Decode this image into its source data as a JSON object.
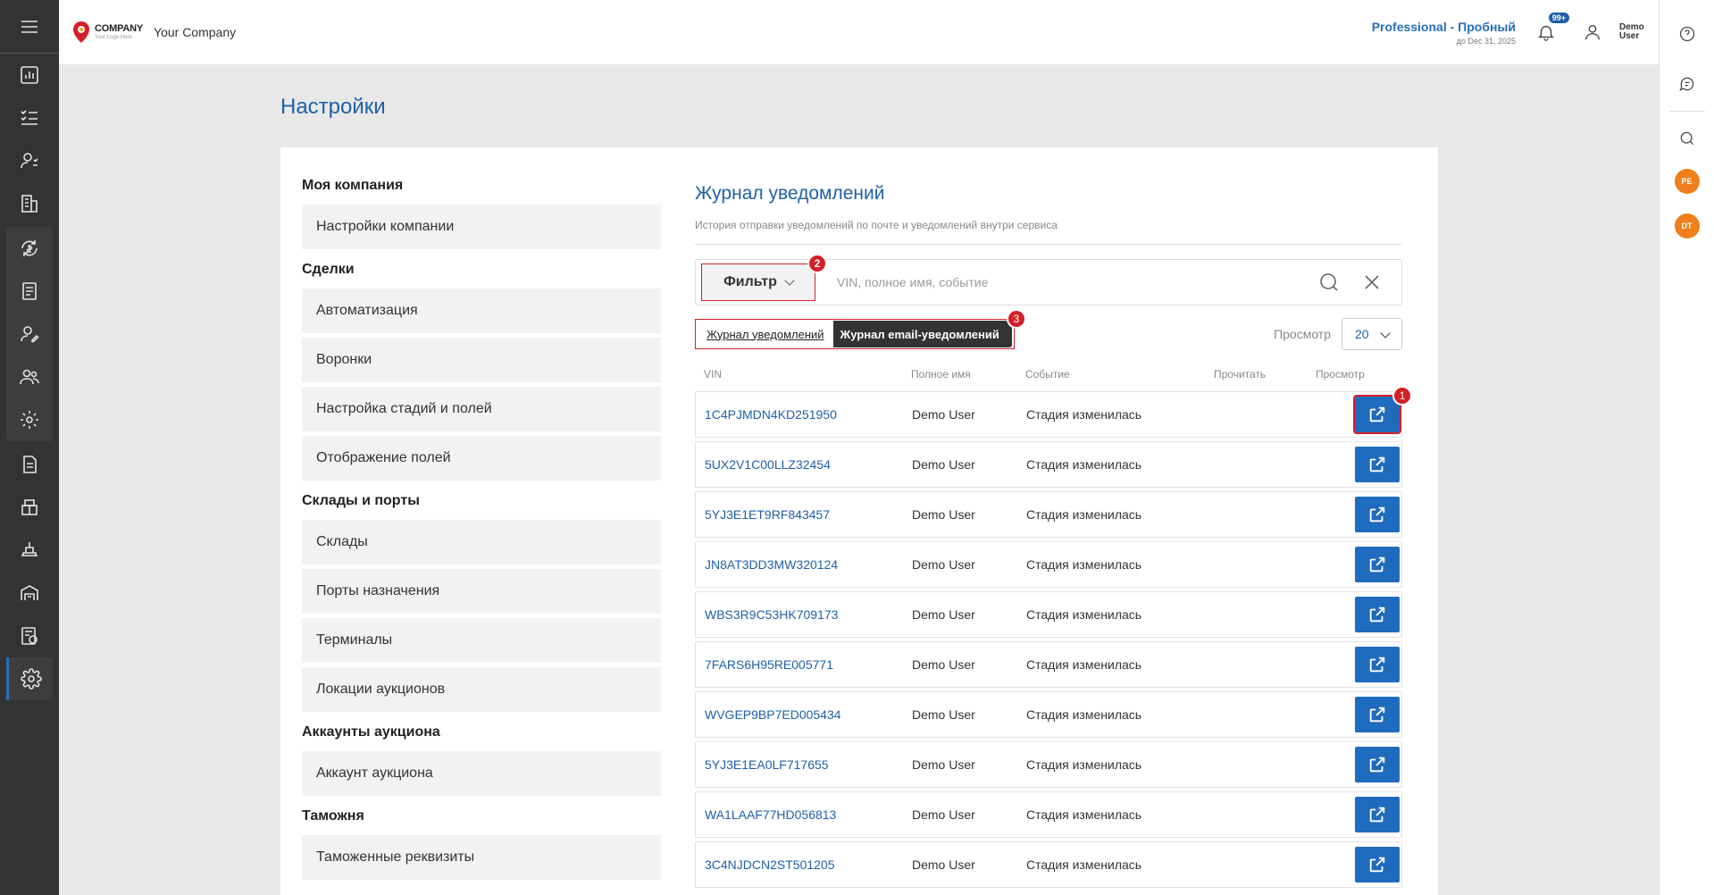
{
  "header": {
    "logo_line1": "COMPANY",
    "logo_line2": "Your Logo Here",
    "company_name": "Your Company",
    "plan_name": "Professional - Пробный",
    "plan_expiry": "до Dec 31, 2025",
    "notifications_badge": "99+",
    "user_name": "Demo User"
  },
  "leftbar": {
    "icons": [
      "menu-icon",
      "dashboard-icon",
      "tasks-icon",
      "clients-icon",
      "buildings-icon",
      "sync-icon",
      "documents-icon",
      "user-edit-icon",
      "users-icon",
      "settings-gear-icon",
      "file-icon",
      "box-icon",
      "conveyor-icon",
      "warehouse-icon",
      "report-icon",
      "settings-icon"
    ]
  },
  "rightbar": {
    "avatars": [
      "PE",
      "DT"
    ]
  },
  "page": {
    "title": "Настройки"
  },
  "settings_nav": [
    {
      "title": "Моя компания",
      "items": [
        "Настройки компании"
      ]
    },
    {
      "title": "Сделки",
      "items": [
        "Автоматизация",
        "Воронки",
        "Настройка стадий и полей",
        "Отображение полей"
      ]
    },
    {
      "title": "Склады и порты",
      "items": [
        "Склады",
        "Порты назначения",
        "Терминалы",
        "Локации аукционов"
      ]
    },
    {
      "title": "Аккаунты аукциона",
      "items": [
        "Аккаунт аукциона"
      ]
    },
    {
      "title": "Таможня",
      "items": [
        "Таможенные реквизиты"
      ]
    }
  ],
  "content": {
    "title": "Журнал уведомлений",
    "description": "История отправки уведомлений по почте и уведомлений внутри сервиса",
    "filter_label": "Фильтр",
    "search_placeholder": "VIN, полное имя, событие",
    "tab_notifications": "Журнал уведомлений",
    "tab_email": "Журнал email-уведомлений",
    "view_label": "Просмотр",
    "view_value": "20",
    "markers": {
      "m1": "1",
      "m2": "2",
      "m3": "3"
    }
  },
  "table": {
    "headers": {
      "vin": "VIN",
      "name": "Полное имя",
      "event": "Событие",
      "read": "Прочитать",
      "view": "Просмотр"
    },
    "rows": [
      {
        "vin": "1C4PJMDN4KD251950",
        "name": "Demo User",
        "event": "Стадия изменилась"
      },
      {
        "vin": "5UX2V1C00LLZ32454",
        "name": "Demo User",
        "event": "Стадия изменилась"
      },
      {
        "vin": "5YJ3E1ET9RF843457",
        "name": "Demo User",
        "event": "Стадия изменилась"
      },
      {
        "vin": "JN8AT3DD3MW320124",
        "name": "Demo User",
        "event": "Стадия изменилась"
      },
      {
        "vin": "WBS3R9C53HK709173",
        "name": "Demo User",
        "event": "Стадия изменилась"
      },
      {
        "vin": "7FARS6H95RE005771",
        "name": "Demo User",
        "event": "Стадия изменилась"
      },
      {
        "vin": "WVGEP9BP7ED005434",
        "name": "Demo User",
        "event": "Стадия изменилась"
      },
      {
        "vin": "5YJ3E1EA0LF717655",
        "name": "Demo User",
        "event": "Стадия изменилась"
      },
      {
        "vin": "WA1LAAF77HD056813",
        "name": "Demo User",
        "event": "Стадия изменилась"
      },
      {
        "vin": "3C4NJDCN2ST501205",
        "name": "Demo User",
        "event": "Стадия изменилась"
      }
    ]
  },
  "colors": {
    "accent": "#1f5fa8",
    "button": "#1f6bbd",
    "marker": "#d42027",
    "sidebar": "#333333",
    "avatar": "#f07e1a"
  }
}
